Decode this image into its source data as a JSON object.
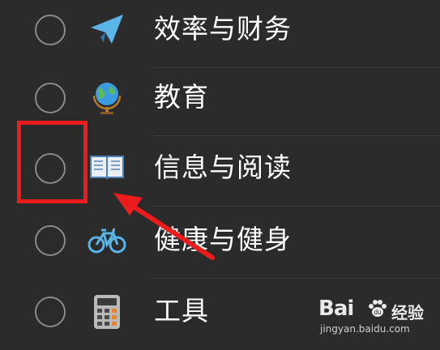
{
  "list": {
    "items": [
      {
        "label": "效率与财务",
        "icon": "paper-plane-icon",
        "selected": false
      },
      {
        "label": "教育",
        "icon": "globe-icon",
        "selected": false
      },
      {
        "label": "信息与阅读",
        "icon": "open-book-icon",
        "selected": false
      },
      {
        "label": "健康与健身",
        "icon": "bicycle-icon",
        "selected": false
      },
      {
        "label": "工具",
        "icon": "calculator-icon",
        "selected": false
      }
    ]
  },
  "annotation": {
    "highlight_color": "#ea1c1c",
    "highlight_target": "radio-信息与阅读"
  },
  "watermark": {
    "brand": "Bai",
    "brand_suffix": "du",
    "cn": "经验",
    "url": "jingyan.baidu.com"
  },
  "colors": {
    "background": "#2b2b2b",
    "text": "#ffffff",
    "radio_border": "#8a8a8a",
    "accent_red": "#ea1c1c"
  }
}
